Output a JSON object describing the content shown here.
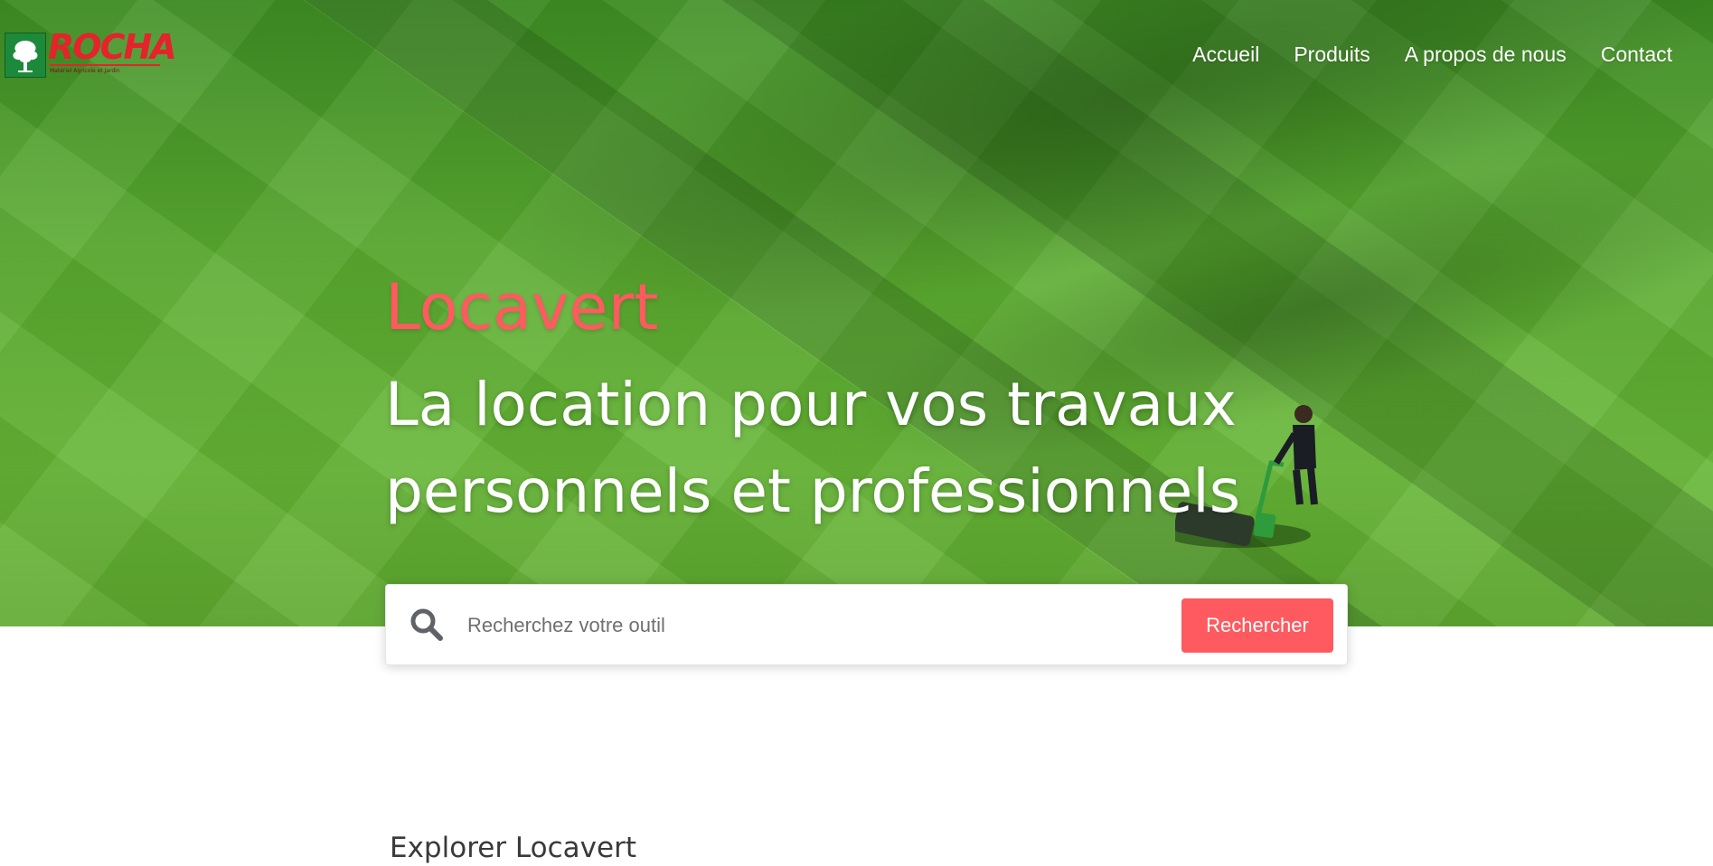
{
  "logo": {
    "name": "ROCHA",
    "subtitle": "Matériel Agricole et Jardin"
  },
  "nav": {
    "items": [
      {
        "label": "Accueil"
      },
      {
        "label": "Produits"
      },
      {
        "label": "A propos de nous"
      },
      {
        "label": "Contact"
      }
    ]
  },
  "hero": {
    "brand": "Locavert",
    "tagline": "La location pour vos travaux personnels et professionnels"
  },
  "search": {
    "placeholder": "Recherchez votre outil",
    "button_label": "Rechercher",
    "icon": "search-icon"
  },
  "explore": {
    "title": "Explorer Locavert"
  },
  "colors": {
    "accent": "#ff5a60",
    "logo_red": "#e4232b",
    "logo_green": "#1c8a3a"
  }
}
